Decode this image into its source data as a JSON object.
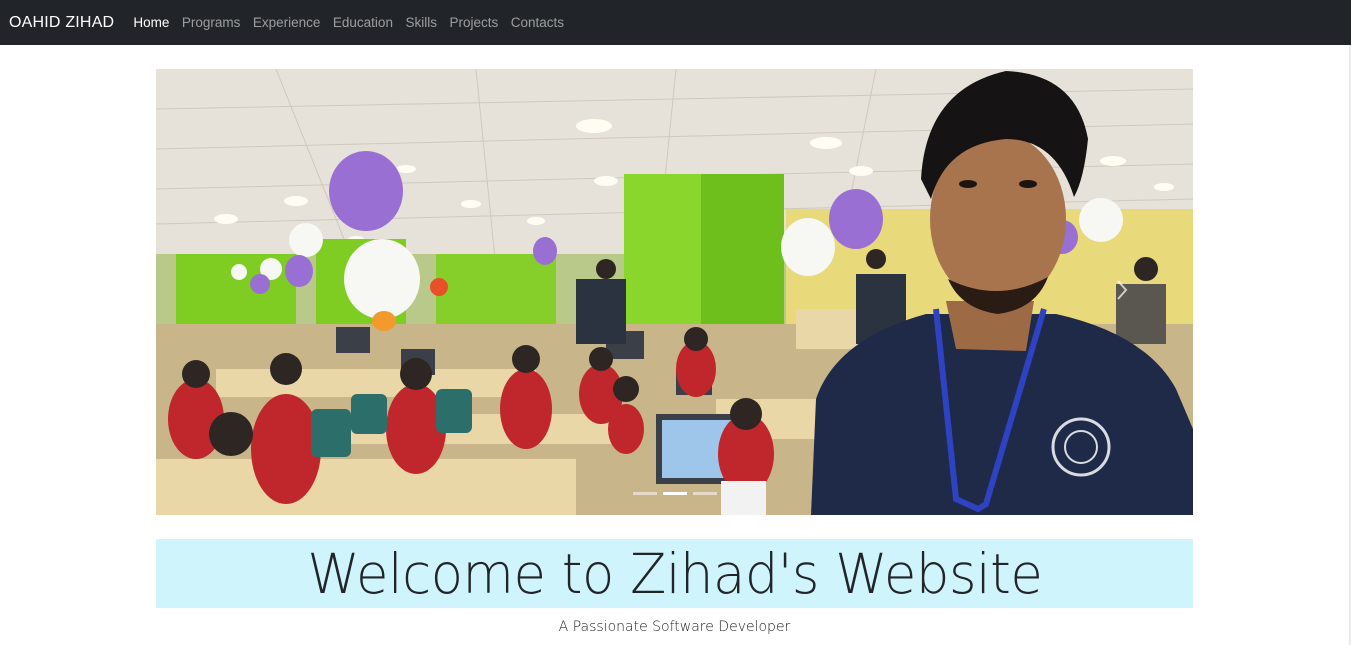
{
  "navbar": {
    "brand": "OAHID ZIHAD",
    "links": [
      "Home",
      "Programs",
      "Experience",
      "Education",
      "Skills",
      "Projects",
      "Contacts"
    ],
    "active": "Home"
  },
  "carousel": {
    "slide_count": 3,
    "active_index": 1,
    "image_alt": "Photo of Zihad at a programming contest hall",
    "next_icon": "chevron-right-icon"
  },
  "hero": {
    "title": "Welcome to Zihad's Website",
    "subtitle": "A Passionate Software Developer"
  },
  "colors": {
    "navbar_bg": "#212529",
    "hero_bg": "#cff4fc",
    "text": "#212529"
  }
}
